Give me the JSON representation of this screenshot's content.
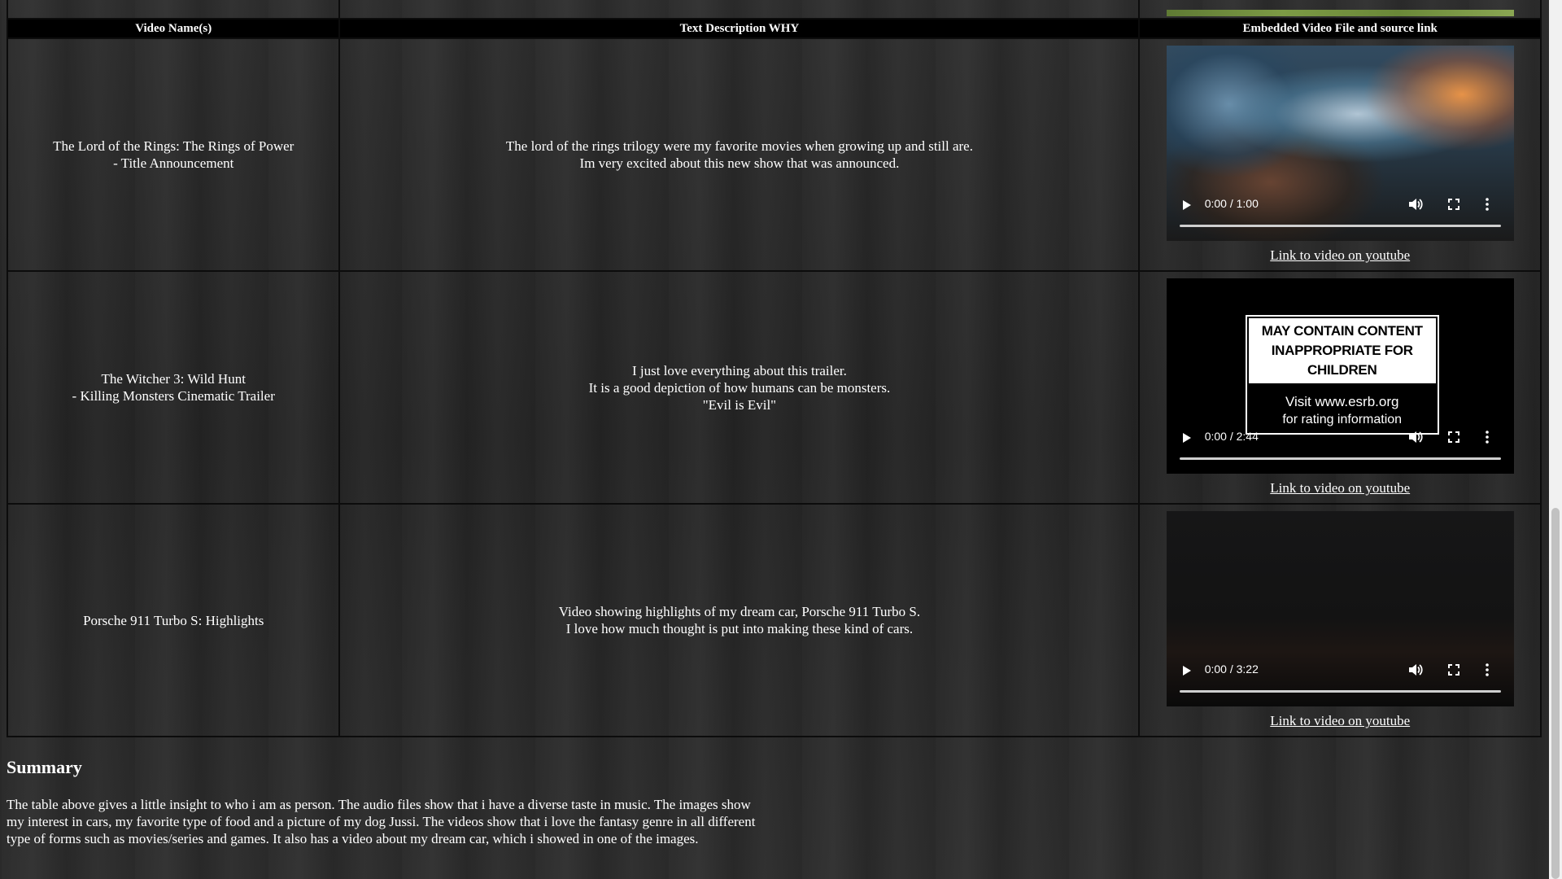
{
  "table": {
    "headers": {
      "name": "Video Name(s)",
      "description": "Text Description WHY",
      "video": "Embedded Video File and source link"
    },
    "rows": [
      {
        "name": "The Lord of the Rings: The Rings of Power\n- Title Announcement",
        "description": "The lord of the rings trilogy were my favorite movies when growing up and still are.\nIm very excited about this new show that was announced.",
        "video": {
          "time": "0:00 / 1:00",
          "poster": "mountain-stream-thumbnail"
        },
        "link": "Link to video on youtube"
      },
      {
        "name": "The Witcher 3: Wild Hunt\n- Killing Monsters Cinematic Trailer",
        "description": "I just love everything about this trailer.\nIt is a good depiction of how humans can be monsters.\n\"Evil is Evil\"",
        "video": {
          "time": "0:00 / 2:44",
          "poster": "esrb-notice-thumbnail",
          "esrb_line1": "MAY CONTAIN CONTENT",
          "esrb_line2": "INAPPROPRIATE FOR CHILDREN",
          "esrb_line3": "Visit www.esrb.org",
          "esrb_line4": "for rating information"
        },
        "link": "Link to video on youtube"
      },
      {
        "name": "Porsche 911 Turbo S: Highlights",
        "description": "Video showing highlights of my dream car, Porsche 911 Turbo S.\nI love how much thought is put into making these kind of cars.",
        "video": {
          "time": "0:00 / 3:22",
          "poster": "dark-thumbnail"
        },
        "link": "Link to video on youtube"
      }
    ]
  },
  "summary": {
    "title": "Summary",
    "text": "The table above gives a little insight to who i am as person. The audio files show that i have a diverse taste in music. The images show my interest in cars, my favorite type of food and a picture of my dog Jussi. The videos show that i love the fantasy genre in all different type of forms such as movies/series and games. It also has a video about my dream car, which i showed in one of the images."
  },
  "icons": {
    "play": "play-icon",
    "volume": "volume-icon",
    "fullscreen": "fullscreen-icon",
    "more": "more-options-icon"
  },
  "colors": {
    "header_bg": "#000000",
    "text": "#ffffff",
    "background": "#2a2a2a"
  }
}
